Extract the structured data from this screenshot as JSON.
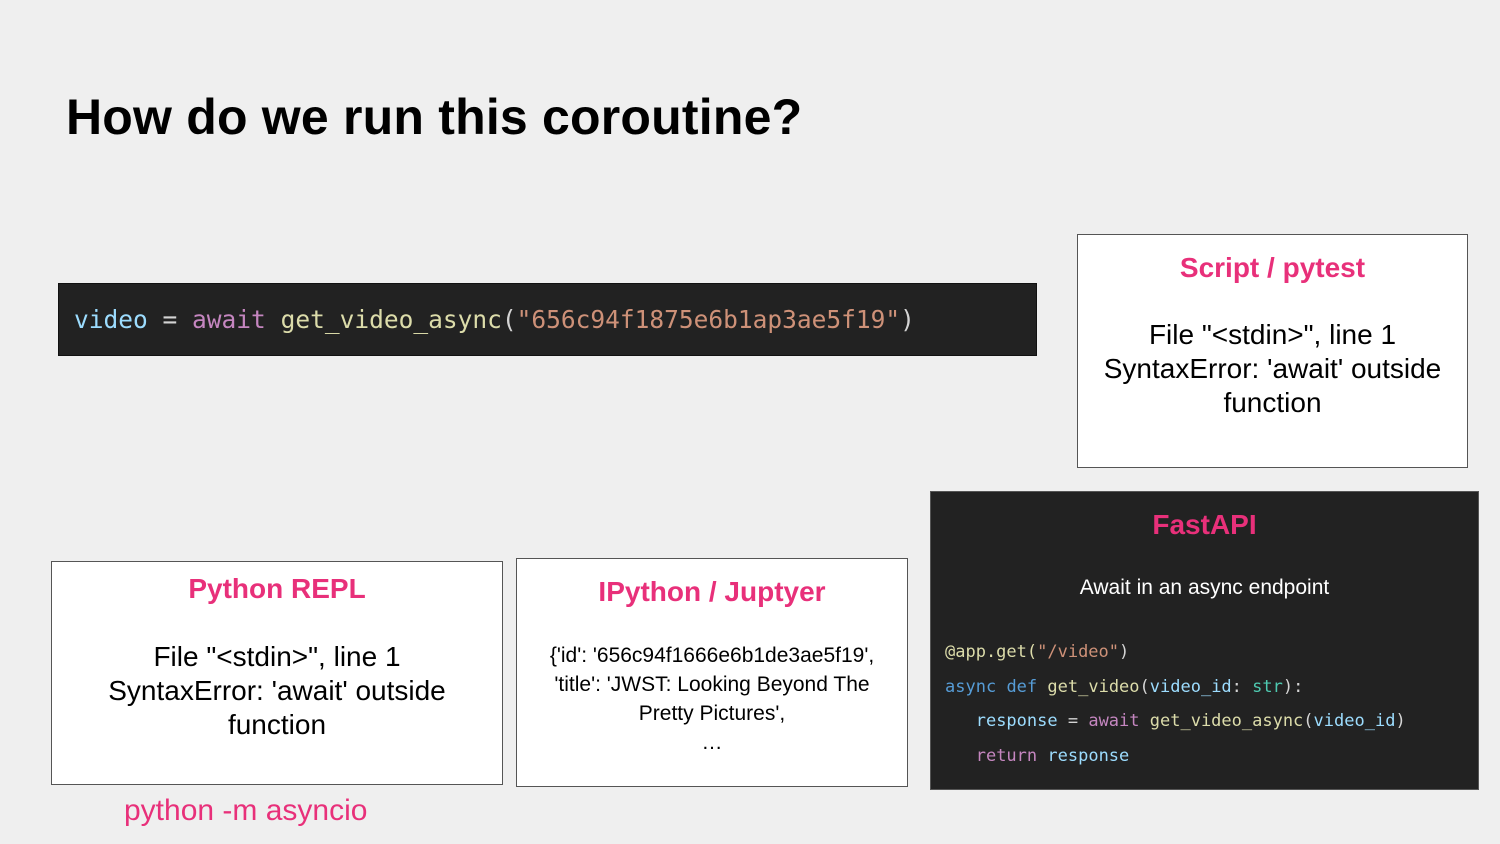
{
  "slide": {
    "title": "How do we run this coroutine?"
  },
  "code_line": {
    "var": "video",
    "eq": " = ",
    "await": "await",
    "fn": "get_video_async",
    "paren_open": "(",
    "arg": "\"656c94f1875e6b1ap3ae5f19\"",
    "paren_close": ")"
  },
  "script_box": {
    "title": "Script / pytest",
    "line1": "File \"<stdin>\", line 1",
    "line2": "SyntaxError: 'await' outside",
    "line3": "function"
  },
  "repl_box": {
    "title": "Python REPL",
    "line1": "File \"<stdin>\", line 1",
    "line2": "SyntaxError: 'await' outside",
    "line3": "function",
    "caption": "python -m asyncio"
  },
  "ipython_box": {
    "title": "IPython / Juptyer",
    "line1": "{'id': '656c94f1666e6b1de3ae5f19',",
    "line2": "'title': 'JWST: Looking Beyond The",
    "line3": "Pretty Pictures',",
    "line4": "…"
  },
  "fastapi_box": {
    "title": "FastAPI",
    "subtitle": "Await in an async endpoint",
    "code": {
      "l1_dec": "@app.get(",
      "l1_str": "\"/video\"",
      "l1_close": ")",
      "l2_async": "async",
      "l2_def": "def",
      "l2_fn": "get_video",
      "l2_open": "(",
      "l2_param": "video_id",
      "l2_colon": ": ",
      "l2_type": "str",
      "l2_close": "):",
      "l3_var": "response",
      "l3_eq": " = ",
      "l3_await": "await",
      "l3_fn": "get_video_async",
      "l3_open": "(",
      "l3_arg": "video_id",
      "l3_close": ")",
      "l4_return": "return",
      "l4_var": "response"
    }
  },
  "colors": {
    "accent": "#e8307a",
    "background": "#efefef",
    "code_bg": "#222222"
  }
}
